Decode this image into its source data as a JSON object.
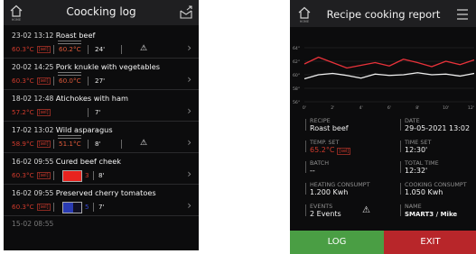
{
  "log": {
    "title": "Coocking log",
    "home_caption": "HOME",
    "entries": [
      {
        "date": "23-02 13:12",
        "name": "Roast beef",
        "temp": "60.3°C",
        "set": "60.2°C",
        "duration": "24'",
        "warning": true
      },
      {
        "date": "20-02 14:25",
        "name": "Pork knukle with vegetables",
        "temp": "60.3°C",
        "set": "60.0°C",
        "duration": "27'",
        "warning": false
      },
      {
        "date": "18-02 12:48",
        "name": "Atichokes with ham",
        "temp": "57.2°C",
        "set": "",
        "duration": "7'",
        "warning": false
      },
      {
        "date": "17-02 13:02",
        "name": "Wild asparagus",
        "temp": "58.9°C",
        "set": "51.1°C",
        "duration": "8'",
        "warning": true
      },
      {
        "date": "16-02 09:55",
        "name": "Cured beef cheek",
        "temp": "60.3°C",
        "swatch": "3",
        "duration": "8'",
        "warning": false
      },
      {
        "date": "16-02 09:55",
        "name": "Preserved cherry tomatoes",
        "temp": "60.3°C",
        "swatch": "5",
        "duration": "7'",
        "warning": false
      },
      {
        "date": "15-02 08:55",
        "name": ""
      }
    ],
    "unit_badge": "[sel]",
    "warning_icon": "warning-triangle-icon",
    "chevron_icon": "chevron-right-icon"
  },
  "report": {
    "title": "Recipe cooking report",
    "home_caption": "HOME",
    "recipe_label": "RECIPE",
    "recipe": "Roast beef",
    "date_label": "DATE",
    "date": "29-05-2021 13:02",
    "temp_set_label": "TEMP. SET",
    "temp_set": "65.2°C",
    "time_set_label": "TIME SET",
    "time_set": "12:30'",
    "batch_label": "BATCH",
    "batch": "--",
    "total_time_label": "TOTAL TIME",
    "total_time": "12:32'",
    "heating_label": "HEATING CONSUMPT",
    "heating": "1.200 Kwh",
    "cooking_label": "COOKING CONSUMPT",
    "cooking": "1.050 Kwh",
    "events_label": "EVENTS",
    "events": "2 Events",
    "name_label": "NAME",
    "name": "SMART3 / Mike",
    "log_button": "LOG",
    "exit_button": "EXIT"
  },
  "colors": {
    "log_button": "#4a9e44",
    "exit_button": "#b8262a",
    "red_temp": "#cf3a2c",
    "swatch_red": "#e8231f",
    "swatch_blue": "#2a3bb3"
  },
  "chart_data": {
    "type": "line",
    "x": [
      0,
      1,
      2,
      3,
      4,
      5,
      6,
      7,
      8,
      9,
      10,
      11,
      12
    ],
    "x_ticks": [
      "0'",
      "2'",
      "4'",
      "6'",
      "8'",
      "10'",
      "12'"
    ],
    "y_ticks": [
      "64°",
      "62°",
      "60°",
      "58°",
      "56°"
    ],
    "ylim": [
      56,
      64
    ],
    "series": [
      {
        "color": "#e8323a",
        "values": [
          61.6,
          62.6,
          61.8,
          61.0,
          61.4,
          61.8,
          61.3,
          62.3,
          61.8,
          61.2,
          62.0,
          61.5,
          62.2
        ]
      },
      {
        "color": "#f0f0f0",
        "values": [
          59.4,
          60.0,
          60.2,
          59.9,
          59.5,
          60.1,
          59.9,
          60.0,
          60.3,
          60.0,
          60.1,
          59.8,
          60.2
        ]
      }
    ]
  }
}
